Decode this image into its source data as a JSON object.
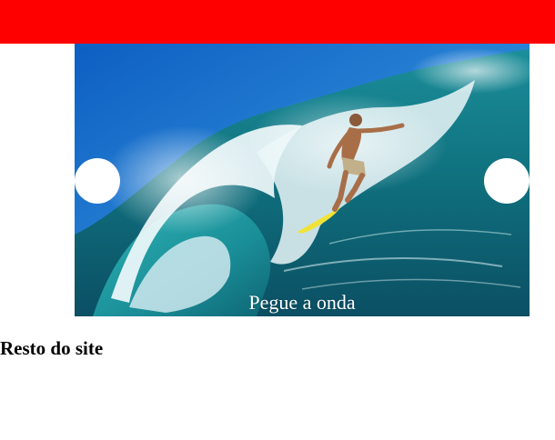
{
  "colors": {
    "header_bar": "#ff0000",
    "page_background": "#ffffff",
    "nav_dot": "#ffffff",
    "caption_text": "#ffffff"
  },
  "slider": {
    "image": "surfer-riding-wave",
    "caption": "Pegue a onda",
    "prev_icon": "circle-prev-icon",
    "next_icon": "circle-next-icon"
  },
  "content": {
    "heading": "Resto do site"
  }
}
